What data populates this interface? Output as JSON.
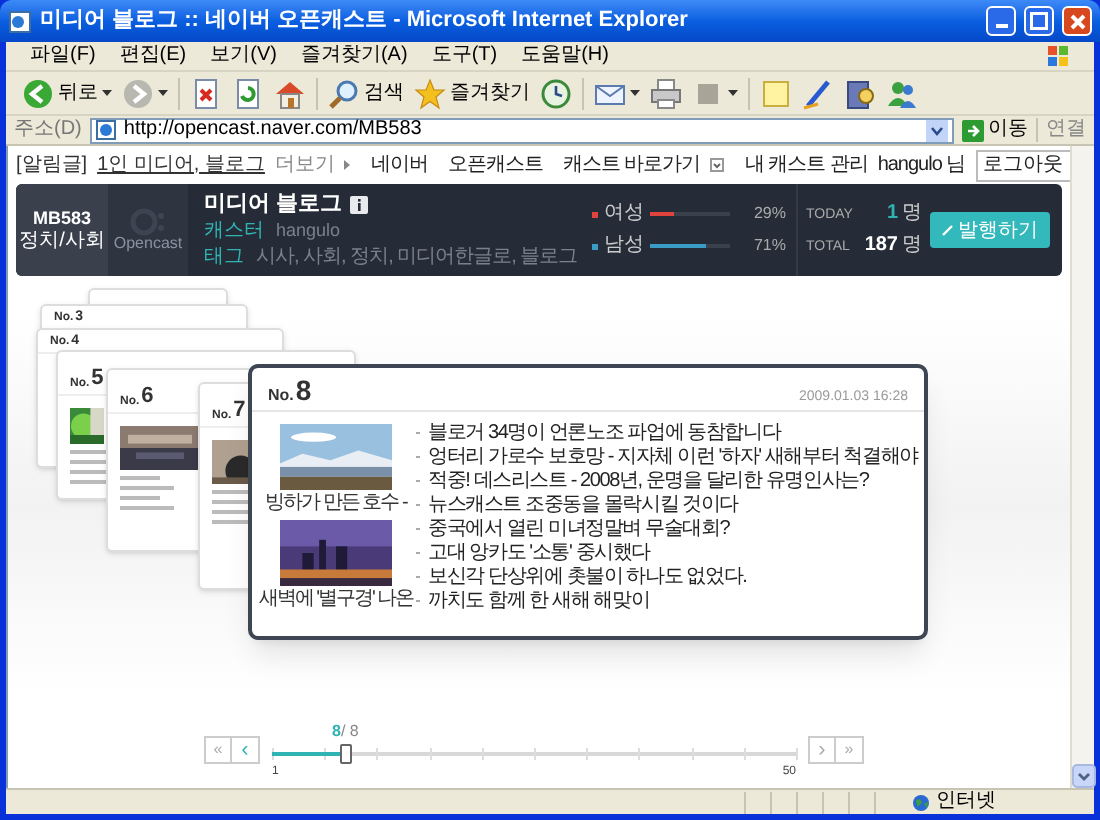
{
  "window": {
    "title": "미디어 블로그 :: 네이버 오픈캐스트 - Microsoft Internet Explorer"
  },
  "menu": [
    "파일(F)",
    "편집(E)",
    "보기(V)",
    "즐겨찾기(A)",
    "도구(T)",
    "도움말(H)"
  ],
  "toolbar": [
    {
      "kind": "back",
      "label": "뒤로"
    },
    {
      "kind": "forward"
    },
    {
      "kind": "stop"
    },
    {
      "kind": "refresh"
    },
    {
      "kind": "home"
    },
    {
      "kind": "search",
      "label": "검색"
    },
    {
      "kind": "favorites",
      "label": "즐겨찾기"
    },
    {
      "kind": "history"
    },
    {
      "kind": "mail"
    },
    {
      "kind": "print"
    },
    {
      "kind": "edit"
    },
    {
      "kind": "note"
    },
    {
      "kind": "pen"
    },
    {
      "kind": "research"
    },
    {
      "kind": "messenger"
    }
  ],
  "address": {
    "label": "주소(D)",
    "value": "http://opencast.naver.com/MB583",
    "go": "이동",
    "links": "연결"
  },
  "page": {
    "topnav": {
      "prefix": "[알림글]",
      "link": "1인 미디어, 블로그",
      "more": "더보기",
      "links": [
        "네이버",
        "오픈캐스트",
        "캐스트 바로가기",
        "내 캐스트 관리"
      ],
      "user": "hangulo 님",
      "logout": "로그아웃"
    },
    "banner": {
      "code": "MB583",
      "category": "정치/사회",
      "logo": "Opencast",
      "title": "미디어 블로그",
      "caster_label": "캐스터",
      "caster": "hangulo",
      "tag_label": "태그",
      "tags": "시사, 사회, 정치, 미디어한글로, 블로그",
      "genders": [
        {
          "label": "여성",
          "color": "#e0443c",
          "level": 0.29,
          "percent": "29%"
        },
        {
          "label": "남성",
          "color": "#3a9cc4",
          "level": 0.71,
          "percent": "71%"
        }
      ],
      "today_label": "TODAY",
      "today": "1",
      "today_unit": "명",
      "total_label": "TOTAL",
      "total": "187",
      "total_unit": "명",
      "subscribe": "발행하기"
    },
    "back_cards": [
      {
        "prefix": "No.",
        "number": "3"
      },
      {
        "prefix": "No.",
        "number": "4"
      },
      {
        "prefix": "No.",
        "number": "5"
      },
      {
        "prefix": "No.",
        "number": "6"
      },
      {
        "prefix": "No.",
        "number": "7"
      }
    ],
    "card": {
      "prefix": "No.",
      "number": "8",
      "date": "2009.01.03 16:28",
      "photos": [
        {
          "caption": "빙하가 만든 호수 -"
        },
        {
          "caption": "새벽에 '별구경' 나온"
        }
      ],
      "headlines": [
        "블로거 34명이 언론노조 파업에 동참합니다",
        "엉터리 가로수 보호망 - 지자체 이런 '하자' 새해부터 척결해야",
        "적중! 데스리스트 - 2008년, 운명을 달리한 유명인사는?",
        "뉴스캐스트 조중동을 몰락시킬 것이다",
        "중국에서 열린 미녀정말벼 무술대회?",
        "고대 앙카도 '소통' 중시했다",
        "보신각 단상위에 촛불이 하나도 없었다.",
        "까치도 함께 한 새해 해맞이"
      ]
    },
    "slider": {
      "current": "8",
      "total": "/ 8",
      "min": "1",
      "max": "50",
      "level": 0.14,
      "first": "«",
      "prev": "‹",
      "next": "›",
      "last": "»"
    }
  },
  "status": {
    "zone": "인터넷"
  }
}
